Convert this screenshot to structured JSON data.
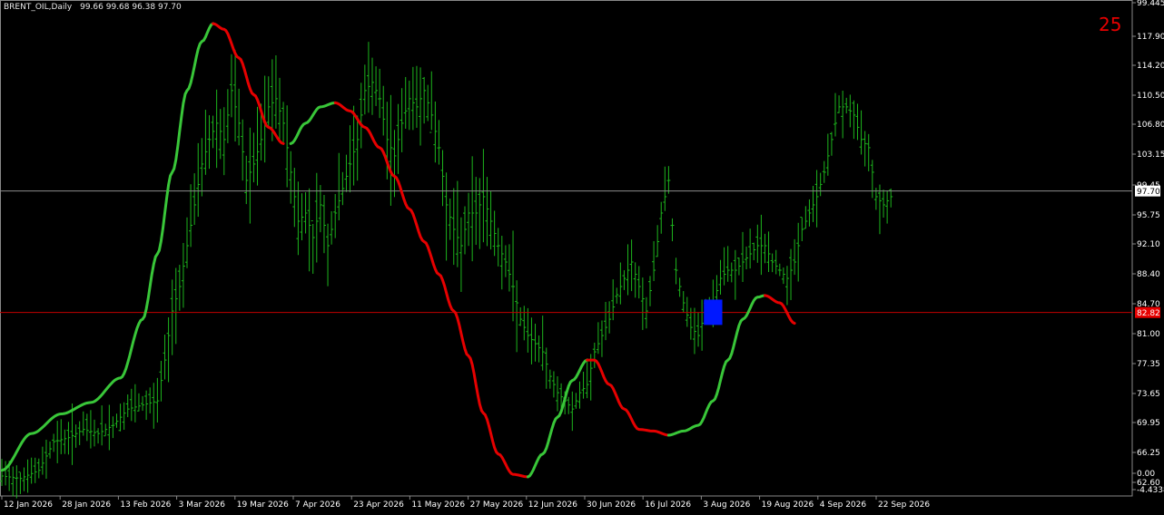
{
  "header": {
    "symbol_label": "BRENT_OIL,Daily",
    "ohlc": "99.66 99.68 96.38 97.70"
  },
  "indicator_value": "25",
  "colors": {
    "background": "#000000",
    "bars": "#1db51d",
    "trend_up": "#39c639",
    "trend_down": "#e60000",
    "price_line": "#8c8c8c",
    "level_line": "#c00000",
    "marker": "#0018ff",
    "axis_text": "#ffffff"
  },
  "price_axis_labels": [
    "99.4454",
    "117.90",
    "114.20",
    "110.50",
    "106.80",
    "103.15",
    "99.45",
    "95.75",
    "92.10",
    "88.40",
    "84.70",
    "81.00",
    "77.35",
    "73.65",
    "69.95",
    "66.25",
    "0.00",
    "62.60",
    "-4.4338"
  ],
  "current_price_tag": "97.70",
  "level_tag": "82.82",
  "date_labels": [
    "12 Jan 2026",
    "28 Jan 2026",
    "13 Feb 2026",
    "3 Mar 2026",
    "19 Mar 2026",
    "7 Apr 2026",
    "23 Apr 2026",
    "11 May 2026",
    "27 May 2026",
    "12 Jun 2026",
    "30 Jun 2026",
    "16 Jul 2026",
    "3 Aug 2026",
    "19 Aug 2026",
    "4 Sep 2026",
    "22 Sep 2026"
  ],
  "chart_data": {
    "type": "line",
    "ylim": [
      60.8,
      120.2
    ],
    "current_price": 97.7,
    "level": 82.82,
    "marker": {
      "day_from": 190,
      "day_to": 194,
      "y_low": 81.3,
      "y_high": 84.4
    },
    "bars_anchor_x_start_day": 0,
    "bars_close_anchors": [
      [
        0,
        62.8
      ],
      [
        5,
        62.5
      ],
      [
        10,
        63.5
      ],
      [
        14,
        67
      ],
      [
        18,
        67.5
      ],
      [
        22,
        68.5
      ],
      [
        26,
        68
      ],
      [
        30,
        69
      ],
      [
        34,
        71
      ],
      [
        38,
        71.5
      ],
      [
        42,
        72
      ],
      [
        44,
        77
      ],
      [
        46,
        83
      ],
      [
        48,
        86
      ],
      [
        50,
        91
      ],
      [
        52,
        96
      ],
      [
        54,
        101
      ],
      [
        56,
        104
      ],
      [
        58,
        106
      ],
      [
        60,
        104
      ],
      [
        62,
        110
      ],
      [
        64,
        106
      ],
      [
        66,
        99
      ],
      [
        68,
        101
      ],
      [
        70,
        104
      ],
      [
        72,
        108
      ],
      [
        74,
        109
      ],
      [
        76,
        106
      ],
      [
        78,
        100
      ],
      [
        80,
        94
      ],
      [
        82,
        95
      ],
      [
        84,
        92
      ],
      [
        86,
        96
      ],
      [
        88,
        91
      ],
      [
        90,
        95
      ],
      [
        92,
        98
      ],
      [
        94,
        101
      ],
      [
        96,
        104
      ],
      [
        98,
        110
      ],
      [
        100,
        111
      ],
      [
        102,
        109
      ],
      [
        104,
        104
      ],
      [
        106,
        102
      ],
      [
        108,
        106
      ],
      [
        110,
        109
      ],
      [
        112,
        108
      ],
      [
        114,
        110
      ],
      [
        116,
        107
      ],
      [
        118,
        103
      ],
      [
        120,
        96
      ],
      [
        122,
        93
      ],
      [
        124,
        91
      ],
      [
        126,
        95
      ],
      [
        128,
        95
      ],
      [
        130,
        97
      ],
      [
        132,
        94
      ],
      [
        134,
        91
      ],
      [
        136,
        89
      ],
      [
        138,
        86
      ],
      [
        140,
        82
      ],
      [
        142,
        80
      ],
      [
        144,
        79
      ],
      [
        146,
        78
      ],
      [
        148,
        75
      ],
      [
        150,
        73
      ],
      [
        152,
        72
      ],
      [
        154,
        71
      ],
      [
        156,
        73
      ],
      [
        158,
        74
      ],
      [
        160,
        78
      ],
      [
        162,
        80
      ],
      [
        164,
        82
      ],
      [
        166,
        85
      ],
      [
        168,
        87
      ],
      [
        170,
        89
      ],
      [
        172,
        86
      ],
      [
        174,
        83
      ],
      [
        176,
        88
      ],
      [
        178,
        95
      ],
      [
        180,
        99
      ],
      [
        182,
        88
      ],
      [
        184,
        84
      ],
      [
        186,
        81
      ],
      [
        188,
        80
      ],
      [
        190,
        83
      ],
      [
        192,
        84
      ],
      [
        194,
        87
      ],
      [
        196,
        88
      ],
      [
        198,
        88
      ],
      [
        200,
        89
      ],
      [
        202,
        90
      ],
      [
        204,
        91
      ],
      [
        206,
        91
      ],
      [
        208,
        89
      ],
      [
        210,
        88
      ],
      [
        212,
        87
      ],
      [
        214,
        89
      ],
      [
        216,
        93
      ],
      [
        218,
        95
      ],
      [
        220,
        97
      ],
      [
        222,
        100
      ],
      [
        224,
        104
      ],
      [
        226,
        108
      ],
      [
        228,
        108
      ],
      [
        230,
        107
      ],
      [
        232,
        104
      ],
      [
        234,
        103
      ],
      [
        236,
        97
      ],
      [
        238,
        96
      ],
      [
        240,
        97
      ]
    ],
    "trend_points": [
      [
        0,
        63.5
      ],
      [
        8,
        68
      ],
      [
        16,
        70.4
      ],
      [
        24,
        71.8
      ],
      [
        32,
        74.8
      ],
      [
        38,
        82
      ],
      [
        42,
        90
      ],
      [
        46,
        100
      ],
      [
        50,
        110
      ],
      [
        54,
        116
      ],
      [
        57,
        118.2
      ],
      [
        60,
        117.5
      ],
      [
        64,
        114
      ],
      [
        68,
        109.5
      ],
      [
        72,
        105.5
      ],
      [
        76,
        103.5
      ],
      [
        78,
        103.5
      ],
      [
        82,
        106
      ],
      [
        86,
        108
      ],
      [
        90,
        108.5
      ],
      [
        94,
        107.5
      ],
      [
        98,
        105.5
      ],
      [
        102,
        103
      ],
      [
        106,
        99.5
      ],
      [
        110,
        95.5
      ],
      [
        114,
        91.5
      ],
      [
        118,
        87.5
      ],
      [
        122,
        83
      ],
      [
        126,
        77.5
      ],
      [
        130,
        70.5
      ],
      [
        134,
        65.5
      ],
      [
        138,
        63
      ],
      [
        142,
        62.7
      ],
      [
        146,
        65.5
      ],
      [
        150,
        70
      ],
      [
        154,
        74.5
      ],
      [
        158,
        77
      ],
      [
        160,
        77
      ],
      [
        164,
        74
      ],
      [
        168,
        71
      ],
      [
        172,
        68.5
      ],
      [
        176,
        68.3
      ],
      [
        180,
        67.8
      ],
      [
        184,
        68.3
      ],
      [
        188,
        69
      ],
      [
        192,
        72
      ],
      [
        196,
        77
      ],
      [
        200,
        82
      ],
      [
        204,
        84.7
      ],
      [
        206,
        84.9
      ],
      [
        210,
        84
      ],
      [
        214,
        81.5
      ]
    ],
    "trend_segments": [
      {
        "from": 0,
        "to": 57,
        "dir": "up"
      },
      {
        "from": 57,
        "to": 76,
        "dir": "down"
      },
      {
        "from": 78,
        "to": 90,
        "dir": "up"
      },
      {
        "from": 90,
        "to": 142,
        "dir": "down"
      },
      {
        "from": 142,
        "to": 158,
        "dir": "up"
      },
      {
        "from": 158,
        "to": 180,
        "dir": "down"
      },
      {
        "from": 180,
        "to": 206,
        "dir": "up"
      },
      {
        "from": 206,
        "to": 214,
        "dir": "down"
      }
    ]
  }
}
